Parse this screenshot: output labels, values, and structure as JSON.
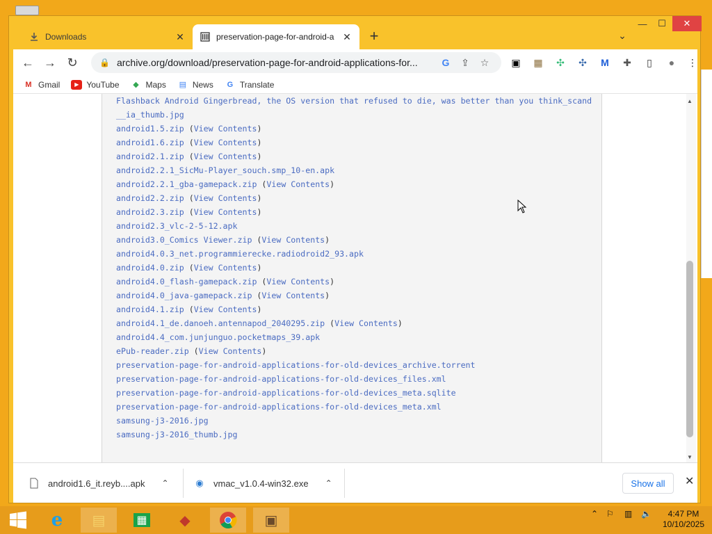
{
  "tabs": [
    {
      "title": "Downloads",
      "icon": "download-icon",
      "active": false
    },
    {
      "title": "preservation-page-for-android-a",
      "icon": "archive-icon",
      "active": true
    }
  ],
  "toolbar": {
    "url": "archive.org/download/preservation-page-for-android-applications-for..."
  },
  "bookmarks": [
    {
      "label": "Gmail",
      "icon": "gmail-icon"
    },
    {
      "label": "YouTube",
      "icon": "youtube-icon"
    },
    {
      "label": "Maps",
      "icon": "maps-icon"
    },
    {
      "label": "News",
      "icon": "news-icon"
    },
    {
      "label": "Translate",
      "icon": "translate-icon"
    }
  ],
  "listing": {
    "view_contents_label": "View Contents",
    "files": [
      {
        "name": "Flashback Android Gingerbread, the OS version that refused to die, was better than you think_scand",
        "contents": false
      },
      {
        "name": "__ia_thumb.jpg",
        "contents": false
      },
      {
        "name": "android1.5.zip",
        "contents": true
      },
      {
        "name": "android1.6.zip",
        "contents": true
      },
      {
        "name": "android2.1.zip",
        "contents": true
      },
      {
        "name": "android2.2.1_SicMu-Player_souch.smp_10-en.apk",
        "contents": false
      },
      {
        "name": "android2.2.1_gba-gamepack.zip",
        "contents": true
      },
      {
        "name": "android2.2.zip",
        "contents": true
      },
      {
        "name": "android2.3.zip",
        "contents": true
      },
      {
        "name": "android2.3_vlc-2-5-12.apk",
        "contents": false
      },
      {
        "name": "android3.0_Comics Viewer.zip",
        "contents": true
      },
      {
        "name": "android4.0.3_net.programmierecke.radiodroid2_93.apk",
        "contents": false
      },
      {
        "name": "android4.0.zip",
        "contents": true
      },
      {
        "name": "android4.0_flash-gamepack.zip",
        "contents": true
      },
      {
        "name": "android4.0_java-gamepack.zip",
        "contents": true
      },
      {
        "name": "android4.1.zip",
        "contents": true
      },
      {
        "name": "android4.1_de.danoeh.antennapod_2040295.zip",
        "contents": true
      },
      {
        "name": "android4.4_com.junjunguo.pocketmaps_39.apk",
        "contents": false
      },
      {
        "name": "ePub-reader.zip",
        "contents": true
      },
      {
        "name": "preservation-page-for-android-applications-for-old-devices_archive.torrent",
        "contents": false
      },
      {
        "name": "preservation-page-for-android-applications-for-old-devices_files.xml",
        "contents": false
      },
      {
        "name": "preservation-page-for-android-applications-for-old-devices_meta.sqlite",
        "contents": false
      },
      {
        "name": "preservation-page-for-android-applications-for-old-devices_meta.xml",
        "contents": false
      },
      {
        "name": "samsung-j3-2016.jpg",
        "contents": false
      },
      {
        "name": "samsung-j3-2016_thumb.jpg",
        "contents": false
      }
    ]
  },
  "downloads": {
    "items": [
      {
        "name": "android1.6_it.reyb....apk",
        "icon": "file-icon"
      },
      {
        "name": "vmac_v1.0.4-win32.exe",
        "icon": "installer-icon"
      }
    ],
    "show_all_label": "Show all"
  },
  "taskbar": {
    "time": "4:47 PM",
    "date": "10/10/2025",
    "apps": [
      "start-icon",
      "internet-explorer-icon",
      "file-explorer-icon",
      "store-icon",
      "app-icon",
      "chrome-icon",
      "app-icon"
    ]
  },
  "colors": {
    "window_frame": "#f9c22b",
    "link": "#4a6bc1",
    "close_button": "#e04343",
    "taskbar": "#e79c1b"
  }
}
